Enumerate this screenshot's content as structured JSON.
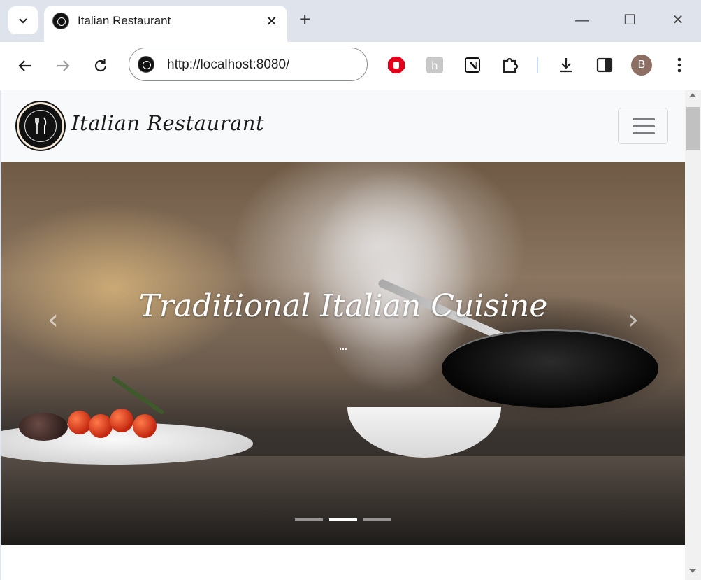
{
  "browser": {
    "tab_title": "Italian Restaurant",
    "tab_close": "✕",
    "new_tab": "+",
    "url": "http://localhost:8080/",
    "avatar_initial": "B",
    "window_controls": {
      "minimize": "—",
      "maximize": "☐",
      "close": "✕"
    }
  },
  "navbar": {
    "brand": "Italian Restaurant",
    "logo_icon": "fork-knife-logo",
    "toggler_icon": "hamburger-icon"
  },
  "carousel": {
    "caption": "Traditional Italian Cuisine",
    "subcaption": "...",
    "prev_icon": "‹",
    "next_icon": "›",
    "slide_count": 3,
    "active_index": 1
  },
  "colors": {
    "chrome_bg": "#dfe3eb",
    "navbar_bg": "#f8f9fa",
    "adblock_red": "#e3001b"
  }
}
